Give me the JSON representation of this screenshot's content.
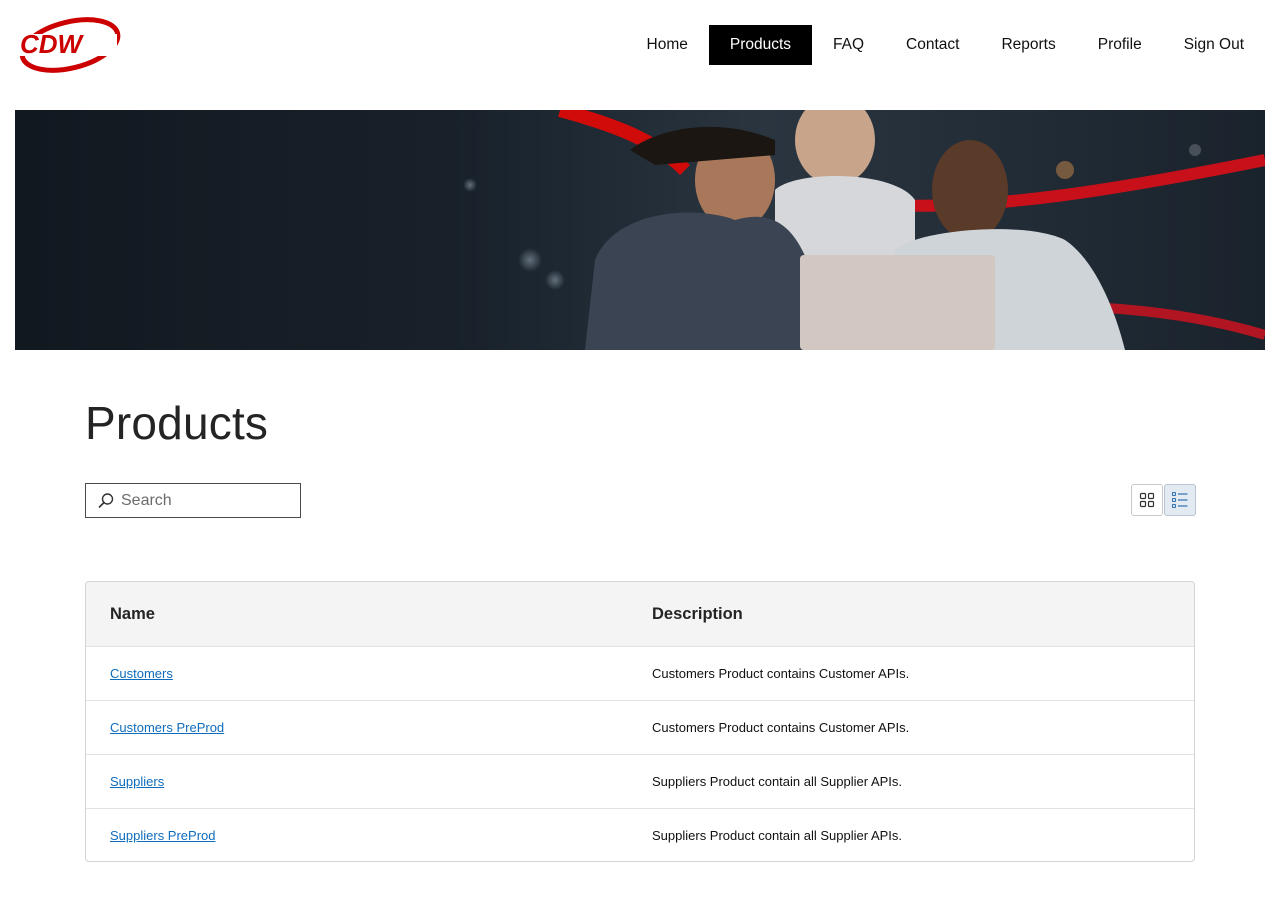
{
  "header": {
    "logo_text": "CDW",
    "nav": [
      {
        "label": "Home",
        "active": false
      },
      {
        "label": "Products",
        "active": true
      },
      {
        "label": "FAQ",
        "active": false
      },
      {
        "label": "Contact",
        "active": false
      },
      {
        "label": "Reports",
        "active": false
      },
      {
        "label": "Profile",
        "active": false
      },
      {
        "label": "Sign Out",
        "active": false
      }
    ]
  },
  "colors": {
    "brand_red": "#cc0000",
    "link_blue": "#0f6cbd",
    "active_nav_bg": "#000000"
  },
  "main": {
    "title": "Products",
    "search": {
      "placeholder": "Search",
      "value": ""
    },
    "view_toggle": {
      "grid_icon": "grid-icon",
      "list_icon": "list-icon",
      "selected": "list"
    }
  },
  "table": {
    "columns": [
      "Name",
      "Description"
    ],
    "rows": [
      {
        "name": "Customers",
        "description": "Customers Product contains Customer APIs."
      },
      {
        "name": "Customers PreProd",
        "description": "Customers Product contains Customer APIs."
      },
      {
        "name": "Suppliers",
        "description": "Suppliers Product contain all Supplier APIs."
      },
      {
        "name": "Suppliers PreProd",
        "description": "Suppliers Product contain all Supplier APIs."
      }
    ]
  }
}
